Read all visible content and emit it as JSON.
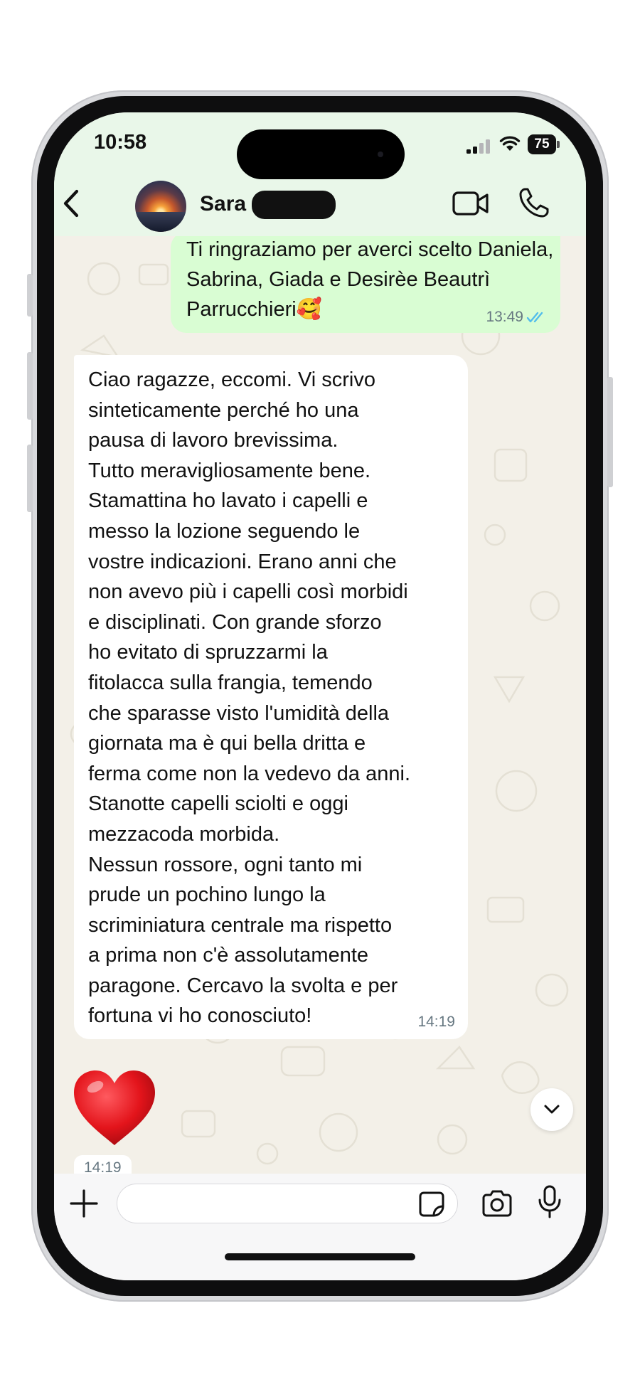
{
  "status_bar": {
    "time": "10:58",
    "battery": "75"
  },
  "header": {
    "contact_name": "Sara",
    "icons": [
      "back-icon",
      "video-camera-icon",
      "phone-icon"
    ]
  },
  "messages": {
    "outgoing": {
      "text": "Ti ringraziamo per averci scelto Daniela, Sabrina, Giada e Desirèe Beautrì Parrucchieri🥰",
      "time": "13:49",
      "status": "read"
    },
    "incoming": {
      "text": "Ciao ragazze, eccomi. Vi scrivo\nsinteticamente perché ho una\npausa di lavoro brevissima.\nTutto meravigliosamente bene.\nStamattina ho lavato i capelli e\nmesso la lozione seguendo le\nvostre indicazioni. Erano anni che\nnon avevo più i capelli così morbidi\ne disciplinati. Con grande sforzo\nho evitato di spruzzarmi la\nfitolacca sulla frangia, temendo\nche sparasse visto l'umidità della\ngiornata ma è qui bella dritta e\nferma come non la vedevo da anni.\nStanotte capelli sciolti e oggi\nmezzacoda morbida.\nNessun rossore, ogni tanto mi\nprude un pochino lungo la\nscriminiatura centrale ma rispetto\na prima non c'è assolutamente\nparagone. Cercavo la svolta e per\nfortuna vi ho conosciuto!",
      "time": "14:19"
    },
    "reaction": {
      "emoji": "heart",
      "time": "14:19"
    }
  },
  "input_bar": {
    "placeholder": "",
    "icons": [
      "plus-icon",
      "sticker-icon",
      "camera-icon",
      "microphone-icon"
    ]
  },
  "colors": {
    "header_bg": "#e9f7e9",
    "outgoing_bubble": "#d9fdd3",
    "incoming_bubble": "#ffffff",
    "read_ticks": "#53bdeb",
    "chat_bg": "#f3f0e8"
  }
}
